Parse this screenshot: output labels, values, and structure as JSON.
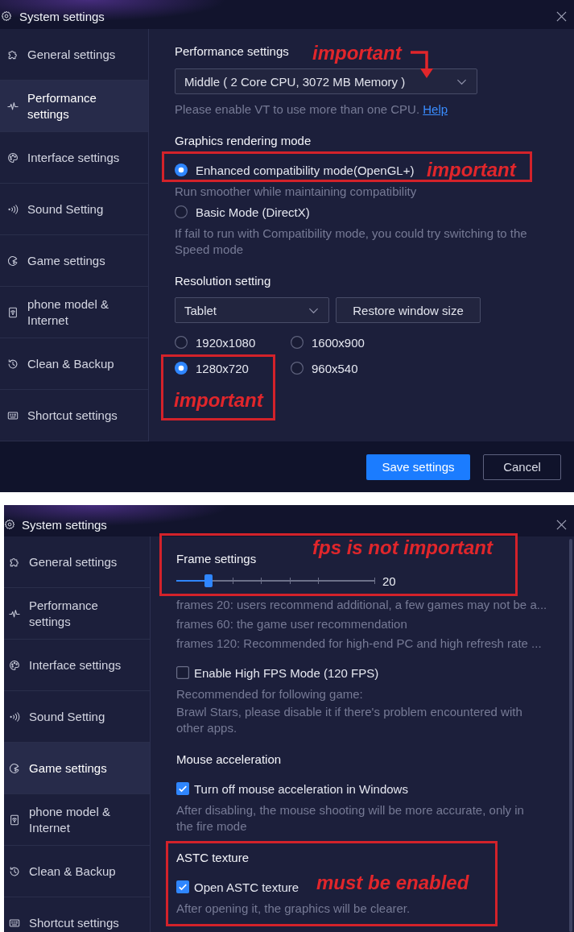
{
  "windows": [
    {
      "title": "System settings",
      "sidebar": [
        {
          "label": "General settings",
          "selected": false
        },
        {
          "label": "Performance settings",
          "selected": true
        },
        {
          "label": "Interface settings",
          "selected": false
        },
        {
          "label": "Sound Setting",
          "selected": false
        },
        {
          "label": "Game settings",
          "selected": false
        },
        {
          "label": "phone model & Internet",
          "selected": false
        },
        {
          "label": "Clean & Backup",
          "selected": false
        },
        {
          "label": "Shortcut settings",
          "selected": false
        }
      ],
      "sections": [
        {
          "heading": "Performance settings",
          "items": [
            {
              "kind": "select",
              "value": "Middle ( 2 Core CPU, 3072 MB Memory )"
            },
            {
              "kind": "hint",
              "text": "Please enable VT to use more than one CPU.",
              "link": "Help"
            }
          ]
        },
        {
          "heading": "Graphics rendering mode",
          "items": [
            {
              "kind": "radio",
              "label": "Enhanced compatibility mode(OpenGL+)",
              "selected": true
            },
            {
              "kind": "note",
              "text": "Run smoother while maintaining compatibility"
            },
            {
              "kind": "radio",
              "label": "Basic Mode (DirectX)",
              "selected": false
            },
            {
              "kind": "note",
              "text": "If fail to run with Compatibility mode, you could try switching to the Speed mode"
            }
          ]
        },
        {
          "heading": "Resolution setting",
          "items": [
            {
              "kind": "select_row",
              "value": "Tablet",
              "button": "Restore window size"
            },
            {
              "kind": "radio_grid",
              "options": [
                {
                  "label": "1920x1080",
                  "selected": false
                },
                {
                  "label": "1600x900",
                  "selected": false
                },
                {
                  "label": "1280x720",
                  "selected": true
                },
                {
                  "label": "960x540",
                  "selected": false
                }
              ]
            }
          ]
        }
      ],
      "footer": {
        "buttons": [
          {
            "label": "Save settings",
            "kind": "primary"
          },
          {
            "label": "Cancel",
            "kind": "secondary"
          }
        ]
      },
      "annotations": [
        {
          "kind": "note",
          "text": "important"
        },
        {
          "kind": "arrow"
        },
        {
          "kind": "box"
        },
        {
          "kind": "note",
          "text": "important"
        },
        {
          "kind": "box"
        },
        {
          "kind": "note",
          "text": "important"
        }
      ]
    },
    {
      "title": "System settings",
      "sidebar": [
        {
          "label": "General settings",
          "selected": false
        },
        {
          "label": "Performance settings",
          "selected": false
        },
        {
          "label": "Interface settings",
          "selected": false
        },
        {
          "label": "Sound Setting",
          "selected": false
        },
        {
          "label": "Game settings",
          "selected": true
        },
        {
          "label": "phone model & Internet",
          "selected": false
        },
        {
          "label": "Clean & Backup",
          "selected": false
        },
        {
          "label": "Shortcut settings",
          "selected": false
        }
      ],
      "sections": [
        {
          "heading": "Frame settings",
          "items": [
            {
              "kind": "slider",
              "level": 0.16,
              "reading": "20"
            },
            {
              "kind": "lines",
              "lines": [
                "frames 20: users recommend additional, a few games may not be a...",
                "frames 60: the game user recommendation",
                "frames 120: Recommended for high-end PC and high refresh rate ..."
              ]
            },
            {
              "kind": "checkbox",
              "label": "Enable High FPS Mode (120 FPS)",
              "checked": false
            },
            {
              "kind": "note",
              "text": "Recommended for following game:"
            },
            {
              "kind": "note",
              "text": "Brawl Stars, please disable it if there's problem encountered with other apps."
            }
          ]
        },
        {
          "heading": "Mouse acceleration",
          "items": [
            {
              "kind": "checkbox",
              "label": "Turn off mouse acceleration in Windows",
              "checked": true
            },
            {
              "kind": "note",
              "text": "After disabling, the mouse shooting will be more accurate, only in the fire mode"
            }
          ]
        },
        {
          "heading": "ASTC texture",
          "items": [
            {
              "kind": "checkbox",
              "label": "Open ASTC texture",
              "checked": true
            },
            {
              "kind": "note",
              "text": "After opening it, the graphics will be clearer."
            }
          ]
        }
      ],
      "scrollbar": true,
      "annotations": [
        {
          "kind": "box"
        },
        {
          "kind": "note",
          "text": "fps is not important"
        },
        {
          "kind": "box"
        },
        {
          "kind": "note",
          "text": "must be enabled"
        }
      ]
    }
  ]
}
